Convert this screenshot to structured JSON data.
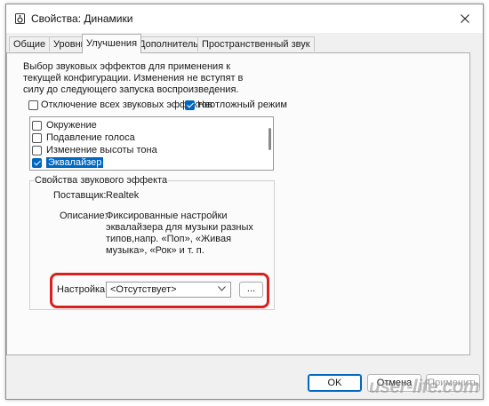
{
  "window": {
    "title": "Свойства: Динамики"
  },
  "tabs": [
    {
      "label": "Общие"
    },
    {
      "label": "Уровни"
    },
    {
      "label": "Улучшения",
      "active": true
    },
    {
      "label": "Дополнительно"
    },
    {
      "label": "Пространственный звук"
    }
  ],
  "enhancements": {
    "description": "Выбор звуковых эффектов для применения к текущей конфигурации. Изменения не вступят в силу до следующего запуска воспроизведения.",
    "disable_all_label": "Отключение всех звуковых эффектов",
    "disable_all_checked": false,
    "immediate_label": "Неотложный режим",
    "immediate_checked": true,
    "effects": [
      {
        "label": "Окружение",
        "checked": false,
        "selected": false
      },
      {
        "label": "Подавление голоса",
        "checked": false,
        "selected": false
      },
      {
        "label": "Изменение высоты тона",
        "checked": false,
        "selected": false
      },
      {
        "label": "Эквалайзер",
        "checked": true,
        "selected": true
      }
    ]
  },
  "properties": {
    "legend": "Свойства звукового эффекта",
    "provider_label": "Поставщик:",
    "provider_value": "Realtek",
    "description_label": "Описание:",
    "description_value": "Фиксированные настройки эквалайзера для музыки разных типов,напр. «Поп», «Живая музыка», «Рок» и т. п.",
    "setting_label": "Настройка:",
    "setting_value": "<Отсутствует>",
    "more_button": "..."
  },
  "footer": {
    "ok": "OK",
    "cancel": "Отмена",
    "apply": "Применить"
  },
  "watermark": "user-life.com",
  "colors": {
    "accent": "#0067c0",
    "highlight": "#d9201f"
  }
}
